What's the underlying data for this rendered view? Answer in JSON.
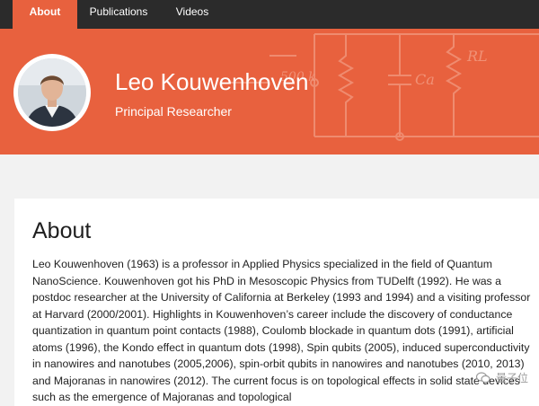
{
  "nav": {
    "tabs": [
      {
        "label": "About",
        "active": true
      },
      {
        "label": "Publications",
        "active": false
      },
      {
        "label": "Videos",
        "active": false
      }
    ]
  },
  "hero": {
    "name": "Leo Kouwenhoven",
    "role": "Principal Researcher",
    "background_color": "#e8613e",
    "circuit_labels": [
      "500 k",
      "Ca",
      "RL"
    ]
  },
  "about": {
    "title": "About",
    "body": "Leo Kouwenhoven (1963) is a professor in Applied Physics specialized in the field of Quantum NanoScience. Kouwenhoven got his PhD in Mesoscopic Physics from TUDelft (1992). He was a postdoc researcher at the University of California at Berkeley (1993 and 1994) and a visiting professor at Harvard (2000/2001). Highlights in Kouwenhoven’s career include the discovery of conductance quantization in quantum point contacts (1988), Coulomb blockade in quantum dots (1991), artificial atoms (1996), the Kondo effect in quantum dots (1998), Spin qubits (2005), induced superconductivity in nanowires and nanotubes (2005,2006), spin-orbit qubits in nanowires and nanotubes (2010, 2013) and Majoranas in nanowires (2012). The current focus is on topological effects in solid state devices such as the emergence of Majoranas and topological"
  },
  "watermark": {
    "text": "量子位"
  }
}
